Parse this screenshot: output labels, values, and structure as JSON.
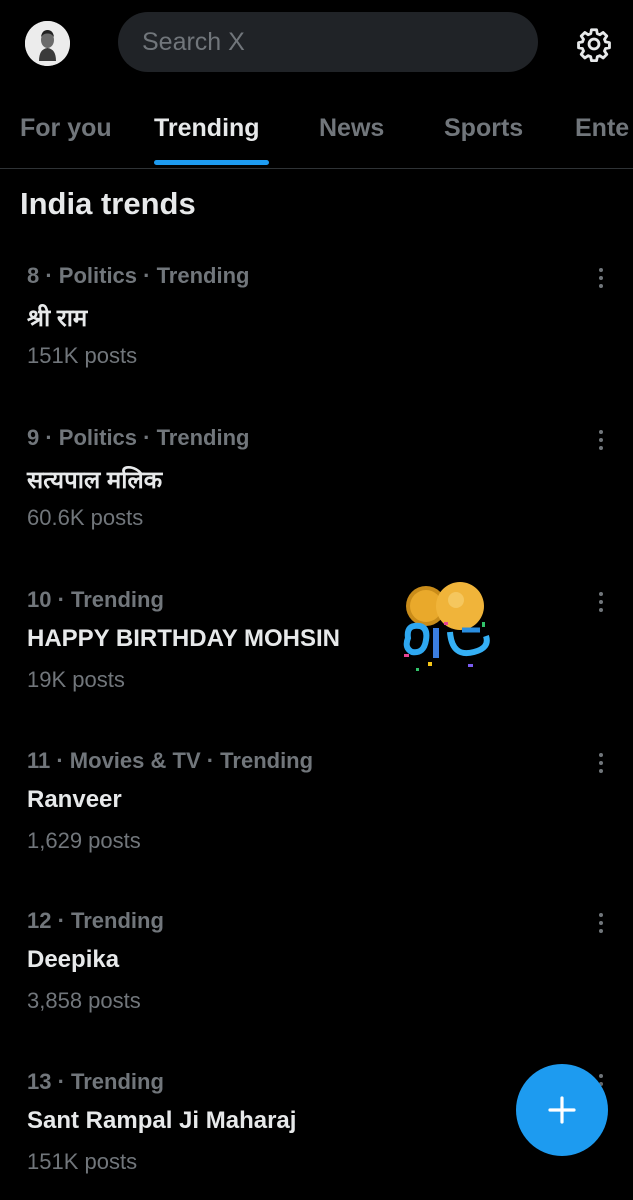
{
  "header": {
    "search_placeholder": "Search X",
    "avatar_icon": "profile-avatar",
    "settings_icon": "gear-icon"
  },
  "tabs": [
    {
      "label": "For you",
      "active": false
    },
    {
      "label": "Trending",
      "active": true
    },
    {
      "label": "News",
      "active": false
    },
    {
      "label": "Sports",
      "active": false
    },
    {
      "label": "Ente",
      "active": false
    }
  ],
  "section_title": "India trends",
  "trends": [
    {
      "meta": "8 · Politics · Trending",
      "name": "श्री राम",
      "posts": "151K posts"
    },
    {
      "meta": "9 · Politics · Trending",
      "name": "सत्यपाल मलिक",
      "posts": "60.6K posts"
    },
    {
      "meta": "10 · Trending",
      "name": "HAPPY BIRTHDAY MOHSIN",
      "posts": "19K posts"
    },
    {
      "meta": "11 · Movies & TV · Trending",
      "name": "Ranveer",
      "posts": "1,629 posts"
    },
    {
      "meta": "12 · Trending",
      "name": "Deepika",
      "posts": "3,858 posts"
    },
    {
      "meta": "13 · Trending",
      "name": "Sant Rampal Ji Maharaj",
      "posts": "151K posts"
    }
  ],
  "colors": {
    "background": "#000000",
    "primary_text": "#e7e9ea",
    "secondary_text": "#71767b",
    "accent": "#1d9bf0",
    "search_bg": "#202327"
  },
  "fab_icon": "plus-icon"
}
